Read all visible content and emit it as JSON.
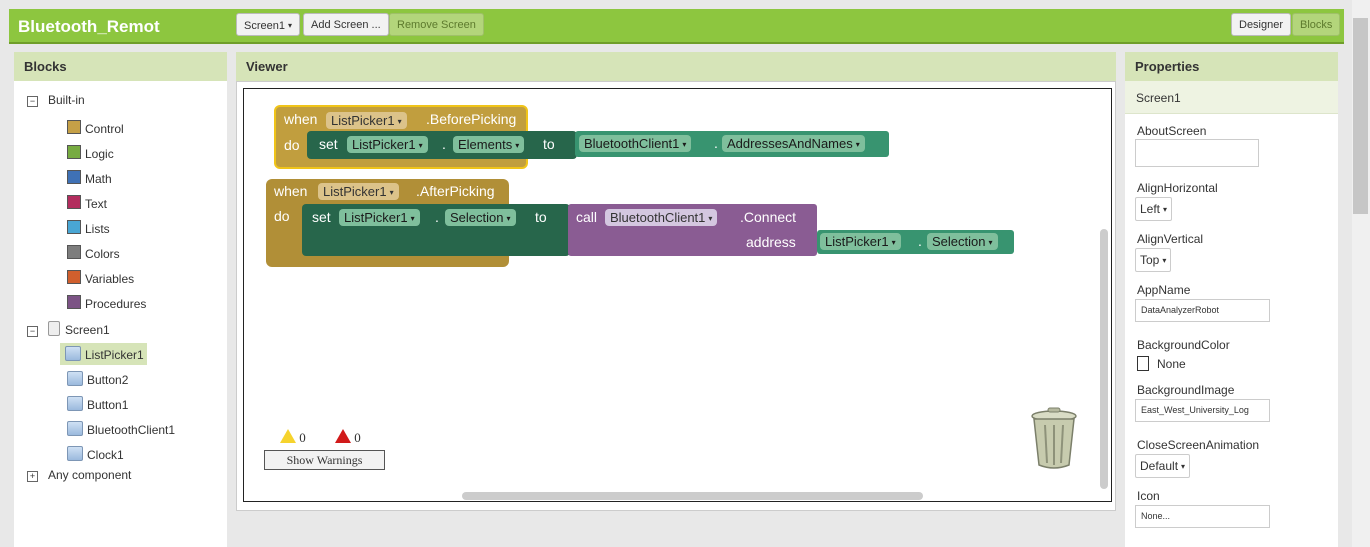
{
  "app": {
    "title": "Bluetooth_Remot"
  },
  "toolbar": {
    "screen_select": "Screen1",
    "add_screen": "Add Screen ...",
    "remove_screen": "Remove Screen",
    "designer": "Designer",
    "blocks": "Blocks"
  },
  "blocks_panel": {
    "title": "Blocks",
    "builtin_label": "Built-in",
    "builtin": [
      {
        "label": "Control",
        "color": "#c5a047"
      },
      {
        "label": "Logic",
        "color": "#77ab41"
      },
      {
        "label": "Math",
        "color": "#3f71b5"
      },
      {
        "label": "Text",
        "color": "#b32d5e"
      },
      {
        "label": "Lists",
        "color": "#49a6d4"
      },
      {
        "label": "Colors",
        "color": "#7d7d7d"
      },
      {
        "label": "Variables",
        "color": "#d05f2d"
      },
      {
        "label": "Procedures",
        "color": "#7c5385"
      }
    ],
    "screen_label": "Screen1",
    "components": [
      "ListPicker1",
      "Button2",
      "Button1",
      "BluetoothClient1",
      "Clock1"
    ],
    "any_component": "Any component"
  },
  "viewer": {
    "title": "Viewer",
    "warnings_count": "0",
    "errors_count": "0",
    "show_warnings": "Show Warnings",
    "block1": {
      "when": "when",
      "component": "ListPicker1",
      "event": ".BeforePicking",
      "do": "do",
      "set": "set",
      "set_component": "ListPicker1",
      "property": "Elements",
      "to": "to",
      "value_component": "BluetoothClient1",
      "value_property": "AddressesAndNames"
    },
    "block2": {
      "when": "when",
      "component": "ListPicker1",
      "event": ".AfterPicking",
      "do": "do",
      "set": "set",
      "set_component": "ListPicker1",
      "property": "Selection",
      "to": "to",
      "call": "call",
      "call_component": "BluetoothClient1",
      "method": ".Connect",
      "address": "address",
      "arg_component": "ListPicker1",
      "arg_property": "Selection"
    }
  },
  "properties": {
    "title": "Properties",
    "screen": "Screen1",
    "about_screen_label": "AboutScreen",
    "align_horizontal_label": "AlignHorizontal",
    "align_horizontal": "Left",
    "align_vertical_label": "AlignVertical",
    "align_vertical": "Top",
    "app_name_label": "AppName",
    "app_name": "DataAnalyzerRobot",
    "background_color_label": "BackgroundColor",
    "background_color": "None",
    "background_image_label": "BackgroundImage",
    "background_image": "East_West_University_Log",
    "close_anim_label": "CloseScreenAnimation",
    "close_anim": "Default",
    "icon_label": "Icon",
    "icon": "None..."
  }
}
